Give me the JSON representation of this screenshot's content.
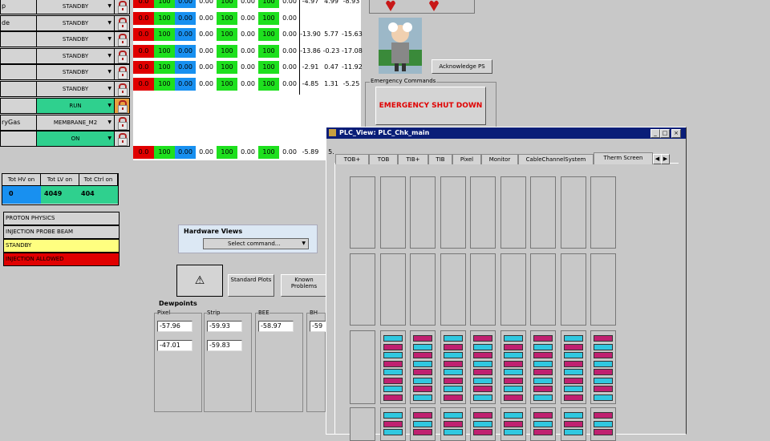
{
  "left_rows": [
    {
      "label": "p",
      "combo": "STANDBY",
      "color": "gray",
      "lock": "gray"
    },
    {
      "label": "de",
      "combo": "STANDBY",
      "color": "gray",
      "lock": "gray"
    },
    {
      "label": "",
      "combo": "STANDBY",
      "color": "gray",
      "lock": "gray"
    },
    {
      "label": "",
      "combo": "STANDBY",
      "color": "gray",
      "lock": "gray"
    },
    {
      "label": "",
      "combo": "STANDBY",
      "color": "gray",
      "lock": "gray"
    },
    {
      "label": "",
      "combo": "STANDBY",
      "color": "gray",
      "lock": "gray"
    },
    {
      "label": "",
      "combo": "RUN",
      "color": "green",
      "lock": "orange"
    },
    {
      "label": "ryGas",
      "combo": "MEMBRANE_M2",
      "color": "gray",
      "lock": "gray"
    },
    {
      "label": "",
      "combo": "ON",
      "color": "green",
      "lock": "gray"
    }
  ],
  "data_rows": [
    [
      "0.0",
      "100",
      "0.00",
      "0.00",
      "100",
      "0.00",
      "100",
      "0.00",
      "-4.97",
      "4.99",
      "-8.93"
    ],
    [
      "0.0",
      "100",
      "0.00",
      "0.00",
      "100",
      "0.00",
      "100",
      "0.00",
      "",
      "",
      ""
    ],
    [
      "0.0",
      "100",
      "0.00",
      "0.00",
      "100",
      "0.00",
      "100",
      "0.00",
      "-13.90",
      "5.77",
      "-15.63"
    ],
    [
      "0.0",
      "100",
      "0.00",
      "0.00",
      "100",
      "0.00",
      "100",
      "0.00",
      "-13.86",
      "-0.23",
      "-17.08"
    ],
    [
      "0.0",
      "100",
      "0.00",
      "0.00",
      "100",
      "0.00",
      "100",
      "0.00",
      "-2.91",
      "0.47",
      "-11.92"
    ],
    [
      "0.0",
      "100",
      "0.00",
      "0.00",
      "100",
      "0.00",
      "100",
      "0.00",
      "-4.85",
      "1.31",
      "-5.25"
    ]
  ],
  "summary_row": [
    "0.0",
    "100",
    "0.00",
    "0.00",
    "100",
    "0.00",
    "100",
    "0.00",
    "-5.89",
    "5.",
    ""
  ],
  "colors": {
    "red": "#e00000",
    "green": "#1ee01e",
    "blue": "#1890f0",
    "teal": "#2fd08e",
    "yellow": "#ffff80",
    "magenta": "#c02070",
    "cyan": "#30c8e0"
  },
  "tot": {
    "headers": [
      "Tot HV on",
      "Tot LV on",
      "Tot Ctrl on"
    ],
    "values": [
      "0",
      "4049",
      "404"
    ]
  },
  "status": [
    "PROTON PHYSICS",
    "INJECTION PROBE BEAM",
    "STANDBY",
    "INJECTION ALLOWED"
  ],
  "hardware": {
    "title": "Hardware Views",
    "select": "Select command..."
  },
  "buttons": {
    "warning": "⚠",
    "standard_plots": "Standard Plots",
    "known_problems": "Known Problems",
    "ack": "Acknowledge PS",
    "emergency": "EMERGENCY SHUT DOWN"
  },
  "emergency_title": "Emergency Commands",
  "dewpoints": {
    "title": "Dewpoints",
    "groups": [
      {
        "label": "Pixel",
        "values": [
          "-57.96",
          "-47.01"
        ]
      },
      {
        "label": "Strip",
        "values": [
          "-59.93",
          "-59.83"
        ]
      },
      {
        "label": "BEE",
        "values": [
          "-58.97"
        ]
      },
      {
        "label": "BH",
        "values": [
          "-59"
        ]
      }
    ]
  },
  "plc": {
    "title": "PLC_View: PLC_Chk_main",
    "tabs": [
      "TOB+",
      "TOB",
      "TIB+",
      "TIB",
      "Pixel",
      "Monitor",
      "CableChannelSystem",
      "Therm Screen"
    ],
    "win_buttons": [
      "_",
      "□",
      "×"
    ]
  }
}
